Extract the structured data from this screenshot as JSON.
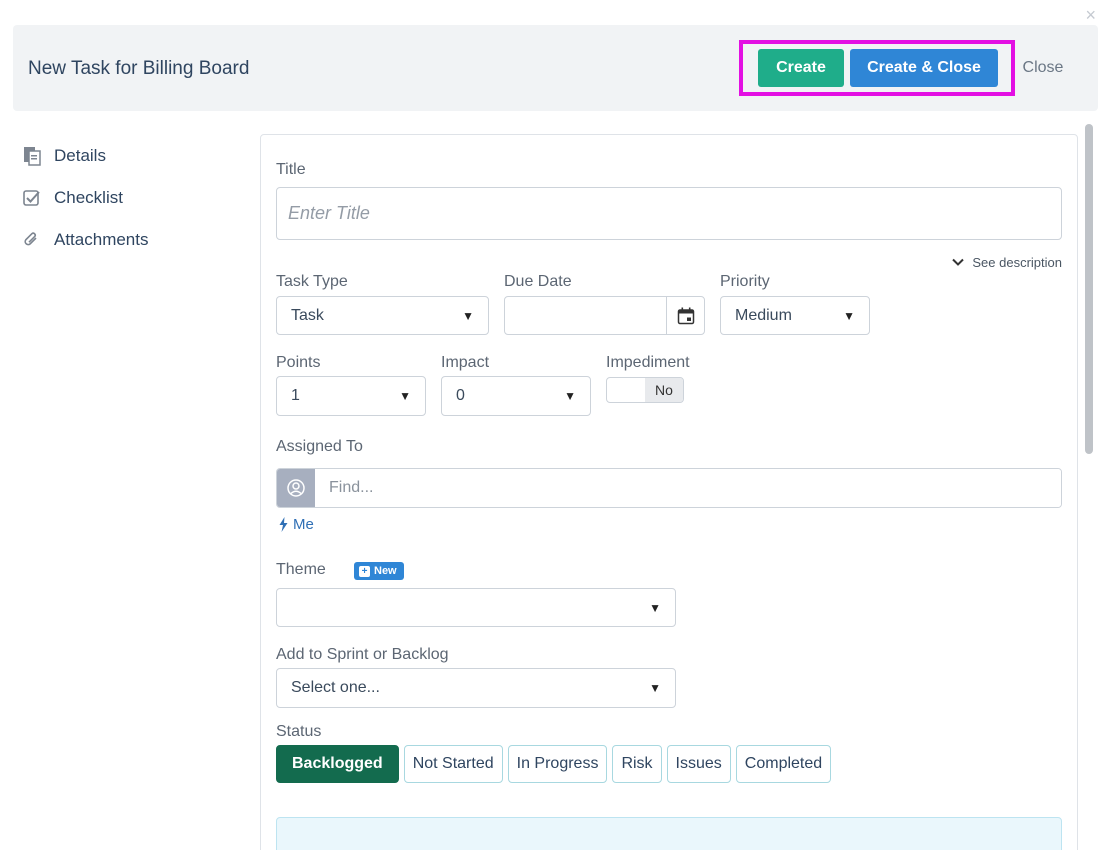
{
  "dialog": {
    "close_glyph": "×"
  },
  "header": {
    "title": "New Task for Billing Board",
    "create_label": "Create",
    "create_close_label": "Create & Close",
    "close_label": "Close"
  },
  "sidebar": {
    "items": [
      {
        "label": "Details",
        "icon": "details-icon"
      },
      {
        "label": "Checklist",
        "icon": "checklist-icon"
      },
      {
        "label": "Attachments",
        "icon": "paperclip-icon"
      }
    ]
  },
  "form": {
    "title_label": "Title",
    "title_placeholder": "Enter Title",
    "see_description": "See description",
    "task_type_label": "Task Type",
    "task_type_value": "Task",
    "due_date_label": "Due Date",
    "priority_label": "Priority",
    "priority_value": "Medium",
    "points_label": "Points",
    "points_value": "1",
    "impact_label": "Impact",
    "impact_value": "0",
    "impediment_label": "Impediment",
    "impediment_value": "No",
    "assigned_label": "Assigned To",
    "assigned_placeholder": "Find...",
    "me_link": "Me",
    "theme_label": "Theme",
    "theme_badge": "New",
    "theme_value": "",
    "sprint_label": "Add to Sprint or Backlog",
    "sprint_value": "Select one...",
    "status_label": "Status",
    "statuses": [
      "Backlogged",
      "Not Started",
      "In Progress",
      "Risk",
      "Issues",
      "Completed"
    ],
    "active_status": "Backlogged"
  },
  "colors": {
    "create": "#1fad8a",
    "create_close": "#2f86d6",
    "highlight": "#e30fe3",
    "status_active": "#136b4e"
  }
}
